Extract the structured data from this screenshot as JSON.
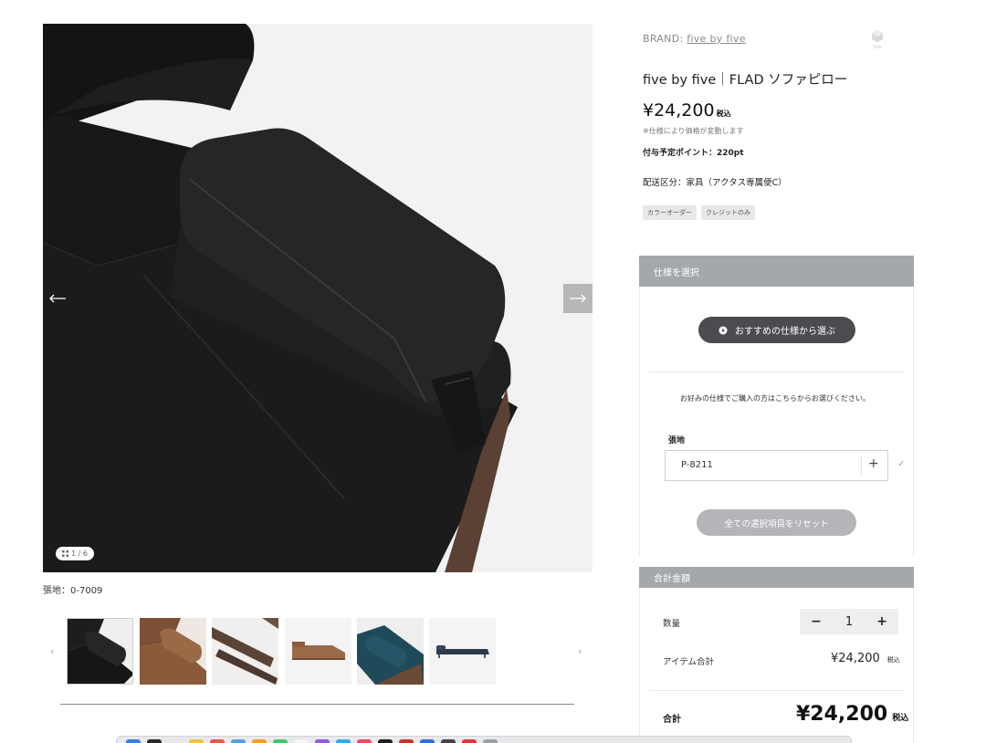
{
  "gallery": {
    "counter": "1 / 6",
    "caption": "張地：0-7009",
    "thumbnails": [
      {
        "name": "black-leather-armrest",
        "color": "#1c1c1c"
      },
      {
        "name": "brown-leather-pillow",
        "color": "#8a5a3b"
      },
      {
        "name": "leather-strap-detail",
        "color": "#5a4436"
      },
      {
        "name": "brown-sofa-corner",
        "color": "#9b6a48"
      },
      {
        "name": "blue-leather-sofa",
        "color": "#1f4a5a"
      },
      {
        "name": "navy-daybed",
        "color": "#2c3a4a"
      }
    ]
  },
  "product": {
    "brand_label": "BRAND:",
    "brand_name": "five by five",
    "logo_text": "FIVE",
    "title": "five by five｜FLAD ソファピロー",
    "price": "¥24,200",
    "price_tax": "税込",
    "price_note": "※仕様により価格が変動します",
    "points": "付与予定ポイント：220pt",
    "shipping": "配送区分：家具（アクタス専属便C）",
    "tags": [
      "カラーオーダー",
      "クレジットのみ"
    ]
  },
  "spec": {
    "header": "仕様を選択",
    "recommend_button": "おすすめの仕様から選ぶ",
    "choose_note": "お好みの仕様でご購入の方はこちらからお選びください。",
    "field_label": "張地",
    "selected_value": "P-8211",
    "reset_button": "全ての選択項目をリセット"
  },
  "total": {
    "header": "合計金額",
    "qty_label": "数量",
    "qty_value": "1",
    "minus": "−",
    "plus": "+",
    "item_total_label": "アイテム合計",
    "item_total": "¥24,200",
    "item_total_tax": "税込",
    "grand_label": "合計",
    "grand_total": "¥24,200",
    "grand_total_tax": "税込"
  },
  "colors": {
    "panel_header": "#a5a8ab",
    "recommend_button": "#4a4c4f",
    "reset_button": "#b3b5b8",
    "check": "#b3a46a"
  }
}
